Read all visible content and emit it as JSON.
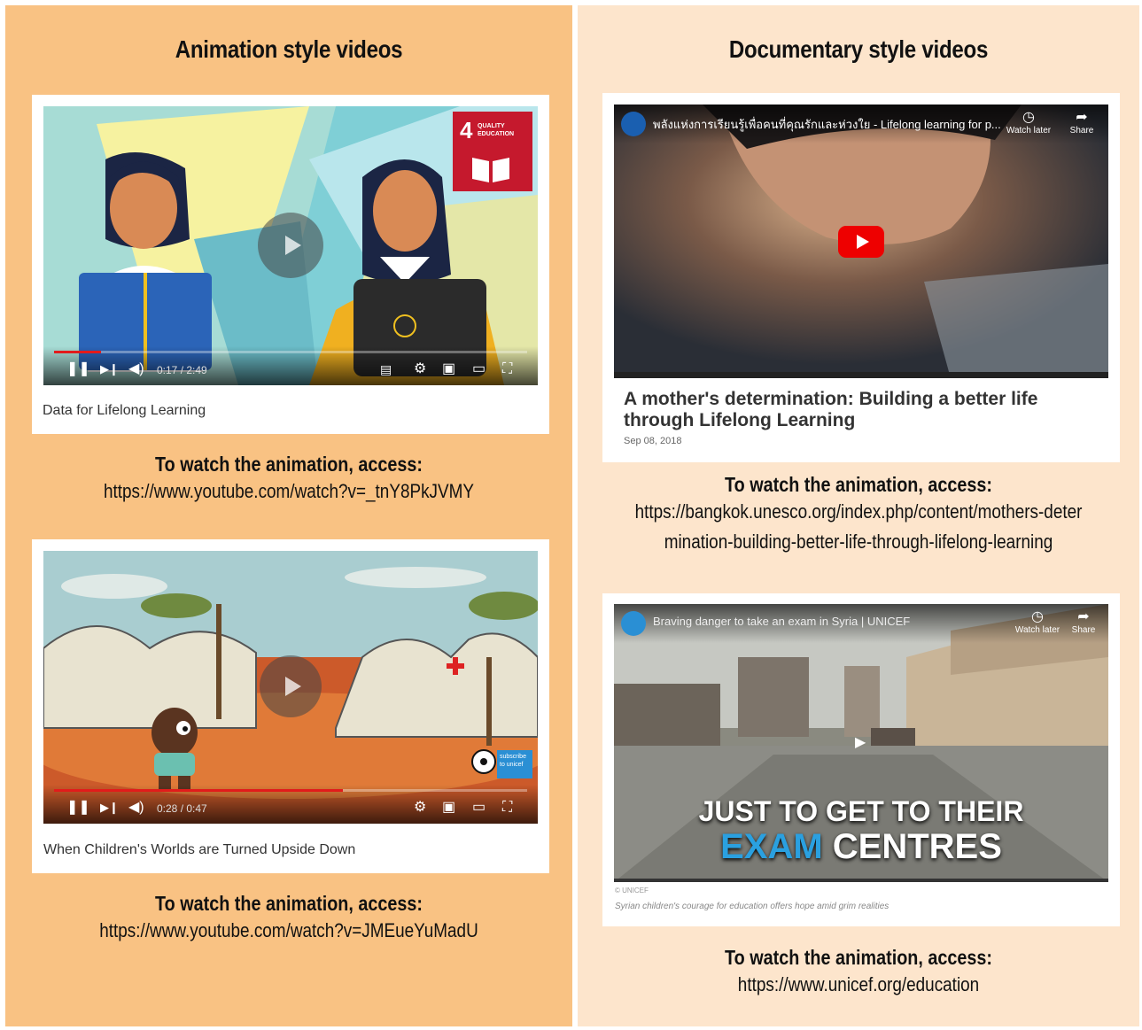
{
  "left": {
    "heading": "Animation style videos",
    "videos": [
      {
        "time": "0:17 / 2:49",
        "progress_fraction": 0.1,
        "caption": "Data for Lifelong Learning",
        "badge_number": "4",
        "badge_text": "QUALITY EDUCATION",
        "access_title": "To watch the animation, access:",
        "access_url": "https://www.youtube.com/watch?v=_tnY8PkJVMY"
      },
      {
        "time": "0:28 / 0:47",
        "progress_fraction": 0.61,
        "caption": "When Children's Worlds are Turned Upside Down",
        "watermark": "subscribe to unicef",
        "access_title": "To watch the animation, access:",
        "access_url": "https://www.youtube.com/watch?v=JMEueYuMadU"
      }
    ]
  },
  "right": {
    "heading": "Documentary style videos",
    "videos": [
      {
        "video_title": "พลังแห่งการเรียนรู้เพื่อคนที่คุณรักและห่วงใย - Lifelong learning for p...",
        "watch_later": "Watch later",
        "share": "Share",
        "article_title": "A mother's determination: Building a better life through Lifelong Learning",
        "date": "Sep 08, 2018",
        "access_title": "To watch the animation, access:",
        "access_url_line1": "https://bangkok.unesco.org/index.php/content/mothers-deter",
        "access_url_line2": "mination-building-better-life-through-lifelong-learning"
      },
      {
        "video_title": "Braving danger to take an exam in Syria | UNICEF",
        "watch_later": "Watch later",
        "share": "Share",
        "overlay_line1": "JUST TO GET TO THEIR",
        "overlay_word_exam": "EXAM",
        "overlay_word_centres": "CENTRES",
        "credit": "© UNICEF",
        "subcaption": "Syrian children's courage for education offers hope amid grim realities",
        "access_title": "To watch the animation, access:",
        "access_url": "https://www.unicef.org/education"
      }
    ]
  },
  "icons": [
    "pause-icon",
    "next-icon",
    "volume-icon",
    "subtitles-icon",
    "settings-gear-icon",
    "miniplayer-icon",
    "theater-icon",
    "fullscreen-icon",
    "clock-icon",
    "share-arrow-icon",
    "play-icon"
  ],
  "colors": {
    "left_bg": "#f9c283",
    "right_bg": "#fde5cc",
    "progress_red": "#e21b1b",
    "sdg_red": "#c5192d",
    "exam_blue": "#2aa0e0"
  }
}
